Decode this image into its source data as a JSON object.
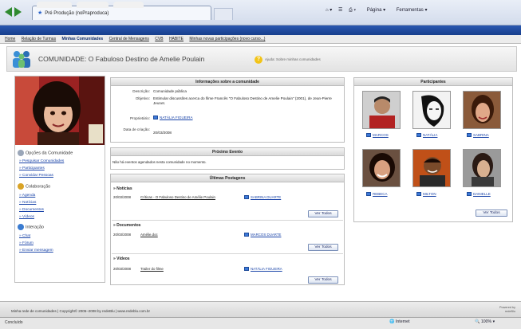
{
  "browser": {
    "tab_title": "Pré Produção (noPraproduca)",
    "tools": [
      "Página",
      "Ferramentas"
    ]
  },
  "site": {
    "menu": [
      "Home",
      "Relação de Turmas",
      "Minhas Comunidades",
      "Central de Mensagens",
      "CVB",
      "HABITE",
      "Minhas novas participações (novo curso...)"
    ]
  },
  "community": {
    "title": "COMUNIDADE: O Fabuloso Destino de Amelie Poulain",
    "help_text": "Ajuda: Sobre minhas comunidades"
  },
  "sidebar": {
    "section1": "Opções da Comunidade",
    "links1": [
      "Pesquisar Comunidades",
      "Participantes",
      "Convidar Pessoas"
    ],
    "section2": "Colaboração",
    "links2": [
      "Agenda",
      "Notícias",
      "Documentos",
      "Vídeos"
    ],
    "section3": "Interação",
    "links3": [
      "Chat",
      "Fórum",
      "Enviar mensagem"
    ]
  },
  "info": {
    "panel_title": "Informações sobre a comunidade",
    "desc_label": "Descrição:",
    "desc_value": "Comunidade pública",
    "obj_label": "Objetivo:",
    "obj_value": "Estimular discussões acerca do filme Francês \"O Fabuloso Destino de Amelie Poulain\" (2001), de Jean-Pierre Jeunet.",
    "owner_label": "Proprietário:",
    "owner_value": "NATÁLIA FIGUEIRA",
    "date_label": "Data de criação:",
    "date_value": "20/03/2008"
  },
  "events": {
    "panel_title": "Próximo Evento",
    "text": "Não há eventos agendados nesta comunidade no momento."
  },
  "posts": {
    "panel_title": "Últimas Postagens",
    "see_all": "Ver Todos",
    "groups": [
      {
        "title": "» Notícias",
        "date": "20/03/2008",
        "item": "Críticas - O Fabuloso Destino de Amélie Poulain",
        "author": "SABRINA DUARTE"
      },
      {
        "title": "» Documentos",
        "date": "20/03/2008",
        "item": "Amélie.doc",
        "author": "MARCOS DUARTE"
      },
      {
        "title": "» Vídeos",
        "date": "20/03/2008",
        "item": "Trailer do filme",
        "author": "NATÁLIA FIGUEIRA"
      }
    ]
  },
  "participants": {
    "panel_title": "Participantes",
    "see_all": "Ver Todos",
    "people": [
      {
        "name": "MARCOS"
      },
      {
        "name": "NATÁLIA"
      },
      {
        "name": "SABRINA"
      },
      {
        "name": "REBECA"
      },
      {
        "name": "MILTON"
      },
      {
        "name": "DANIELLE"
      }
    ]
  },
  "footer": {
    "text": "Minha rede de comunidades | Copyright© 2005–2008 by redeBlu | www.redeblu.com.br",
    "powered": "Powered by redeBlu"
  },
  "status": {
    "left": "Concluído",
    "zone": "Internet",
    "zoom": "100%"
  },
  "colors": {
    "nav_blue": "#1f4a9e",
    "link": "#1a44a8"
  }
}
